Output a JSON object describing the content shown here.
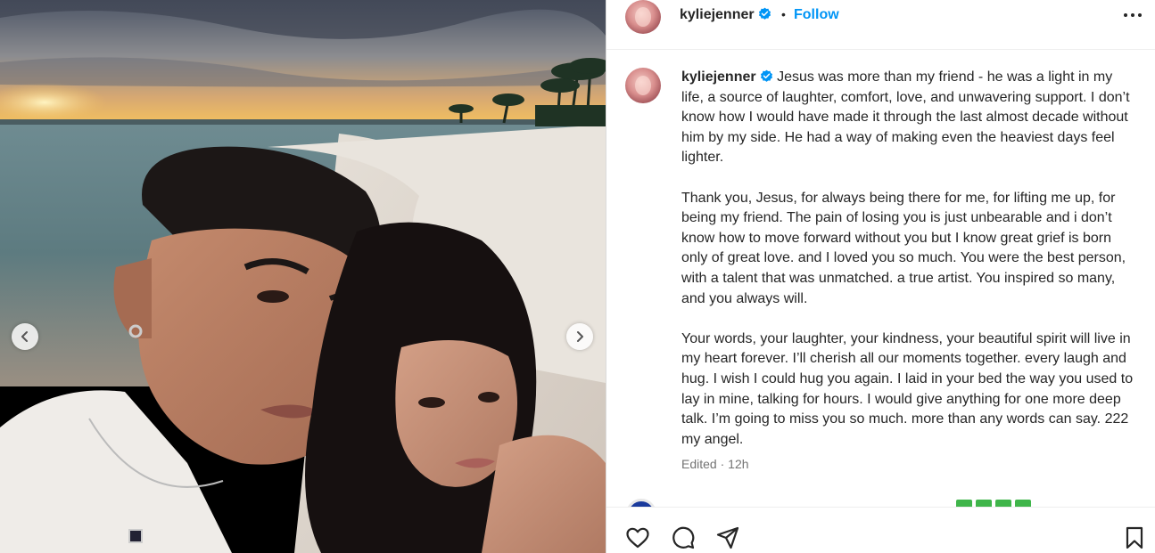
{
  "post": {
    "username": "kyliejenner",
    "follow_label": "Follow",
    "separator": "•",
    "caption_paragraphs": [
      "Jesus was more than my friend - he was a light in my life, a source of laughter, comfort, love, and unwavering support. I don’t know how I would have made it through the last almost decade without him by my side. He had a way of making even the heaviest days feel lighter.",
      "Thank you, Jesus, for always being there for me, for lifting me up, for being my friend. The pain of losing you is just unbearable and i don’t know how to move forward without you but I know great grief is born only of great love. and I loved you so much. You were the best person, with a talent that was unmatched. a true artist. You inspired so many, and you always will.",
      "Your words, your laughter, your kindness, your beautiful spirit will live in my heart forever. I’ll cherish all our moments together. every laugh and hug. I wish I could hug you again. I laid in your bed the way you used to lay in mine, talking for hours. I would give anything for one more deep talk. I’m going to miss you so much. more than any words can say. 222 my angel."
    ],
    "edited_label": "Edited",
    "edited_time": "12h",
    "edited_sep": " · "
  },
  "icons": {
    "verified": "verified-badge-icon",
    "more": "more-options-icon",
    "like": "heart-icon",
    "comment": "comment-icon",
    "share": "share-icon",
    "save": "bookmark-icon",
    "prev": "chevron-left-icon",
    "next": "chevron-right-icon"
  },
  "colors": {
    "accent": "#0095f6",
    "verified": "#0095f6",
    "text": "#262626",
    "secondary_text": "#737373"
  }
}
